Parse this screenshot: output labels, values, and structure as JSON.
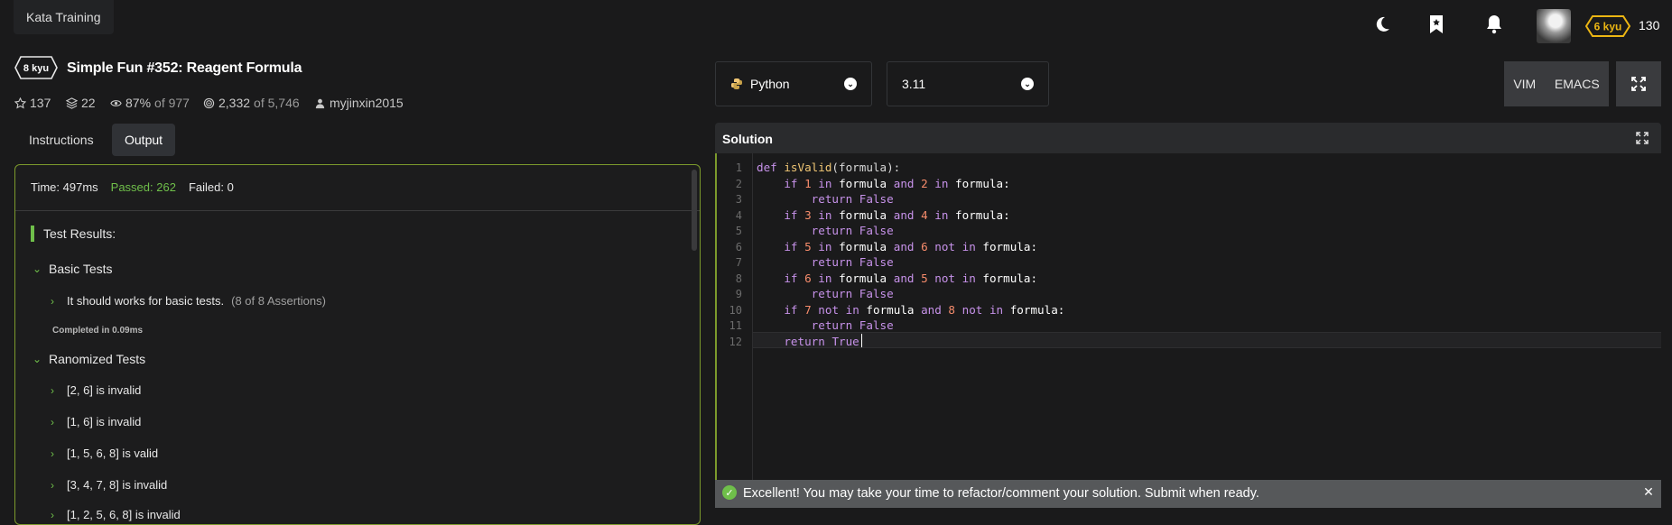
{
  "header": {
    "app_label": "Kata Training",
    "rank": "6 kyu",
    "honor": "130"
  },
  "kata": {
    "kyu": "8 kyu",
    "title": "Simple Fun #352: Reagent Formula",
    "stars": "137",
    "collections": "22",
    "satisfaction_pct": "87%",
    "satisfaction_of": "of 977",
    "completed": "2,332",
    "completed_of": "of 5,746",
    "author": "myjinxin2015"
  },
  "tabs": {
    "instructions": "Instructions",
    "output": "Output"
  },
  "output": {
    "time": "Time: 497ms",
    "passed": "Passed: 262",
    "failed": "Failed: 0",
    "results_title": "Test Results:",
    "basic_group": "Basic Tests",
    "basic_test": "It should works for basic tests.",
    "basic_assertions": "(8 of 8 Assertions)",
    "completed_in": "Completed in 0.09ms",
    "random_group": "Ranomized Tests",
    "random_tests": [
      "[2, 6] is invalid",
      "[1, 6] is invalid",
      "[1, 5, 6, 8] is valid",
      "[3, 4, 7, 8] is invalid",
      "[1, 2, 5, 6, 8] is invalid"
    ]
  },
  "toolbar": {
    "language": "Python",
    "version": "3.11",
    "vim": "VIM",
    "emacs": "EMACS"
  },
  "solution": {
    "title": "Solution",
    "line_numbers": [
      "1",
      "2",
      "3",
      "4",
      "5",
      "6",
      "7",
      "8",
      "9",
      "10",
      "11",
      "12"
    ],
    "code": {
      "l1_def": "def",
      "l1_name": "isValid",
      "l1_rest": "(formula):",
      "if": "if",
      "in": "in",
      "and": "and",
      "not": "not",
      "return": "return",
      "formula": "formula",
      "formula_colon": "formula:",
      "false": "False",
      "true": "True",
      "n1": "1",
      "n2": "2",
      "n3": "3",
      "n4": "4",
      "n5": "5",
      "n6": "6",
      "n7": "7",
      "n8": "8"
    }
  },
  "notification": {
    "message": "Excellent! You may take your time to refactor/comment your solution. Submit when ready."
  },
  "colors": {
    "accent_green": "#6fbf4a",
    "rank_yellow": "#ecb613",
    "panel_border": "#7c9a2c"
  }
}
